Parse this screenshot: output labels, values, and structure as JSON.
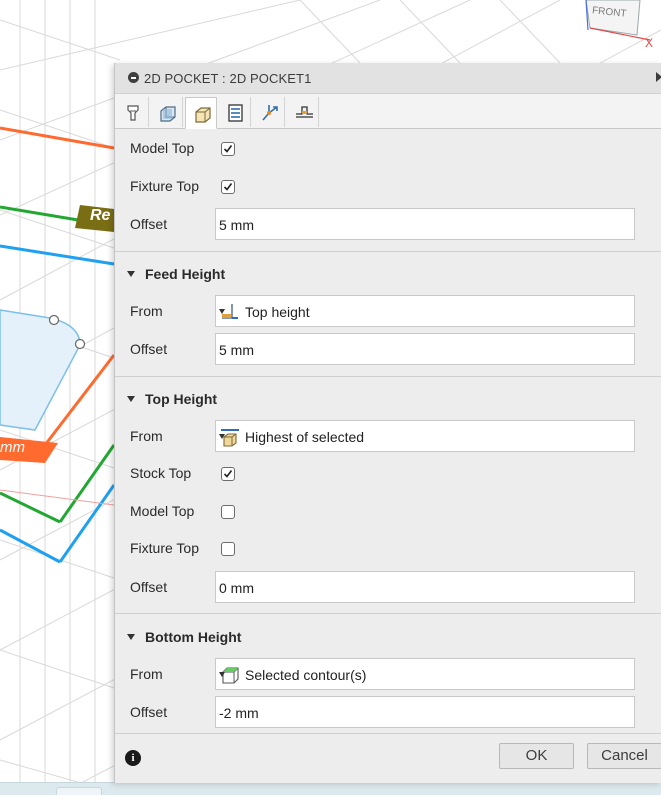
{
  "viewport": {
    "sketch_label": "Re",
    "dimension_label": "mm",
    "viewcube": {
      "face_label": "FRONT",
      "axis_label": "X"
    }
  },
  "dialog": {
    "title": "2D POCKET : 2D POCKET1",
    "tabs": [
      {
        "name": "tool",
        "icon": "tool-icon"
      },
      {
        "name": "geometry",
        "icon": "geometry-icon"
      },
      {
        "name": "heights",
        "icon": "heights-icon",
        "active": true
      },
      {
        "name": "passes",
        "icon": "passes-icon"
      },
      {
        "name": "linking",
        "icon": "linking-icon"
      },
      {
        "name": "shaft",
        "icon": "shaft-icon"
      }
    ],
    "top_block": {
      "model_top": {
        "label": "Model Top",
        "checked": true
      },
      "fixture_top": {
        "label": "Fixture Top",
        "checked": true
      },
      "offset": {
        "label": "Offset",
        "value": "5 mm"
      }
    },
    "feed_height": {
      "title": "Feed Height",
      "from": {
        "label": "From",
        "value": "Top height"
      },
      "offset": {
        "label": "Offset",
        "value": "5 mm"
      }
    },
    "top_height": {
      "title": "Top Height",
      "from": {
        "label": "From",
        "value": "Highest of selected"
      },
      "stock_top": {
        "label": "Stock Top",
        "checked": true
      },
      "model_top": {
        "label": "Model Top",
        "checked": false
      },
      "fixture_top": {
        "label": "Fixture Top",
        "checked": false
      },
      "offset": {
        "label": "Offset",
        "value": "0 mm"
      }
    },
    "bottom_height": {
      "title": "Bottom Height",
      "from": {
        "label": "From",
        "value": "Selected contour(s)"
      },
      "offset": {
        "label": "Offset",
        "value": "-2 mm"
      }
    },
    "footer": {
      "ok_label": "OK",
      "cancel_label": "Cancel"
    }
  }
}
